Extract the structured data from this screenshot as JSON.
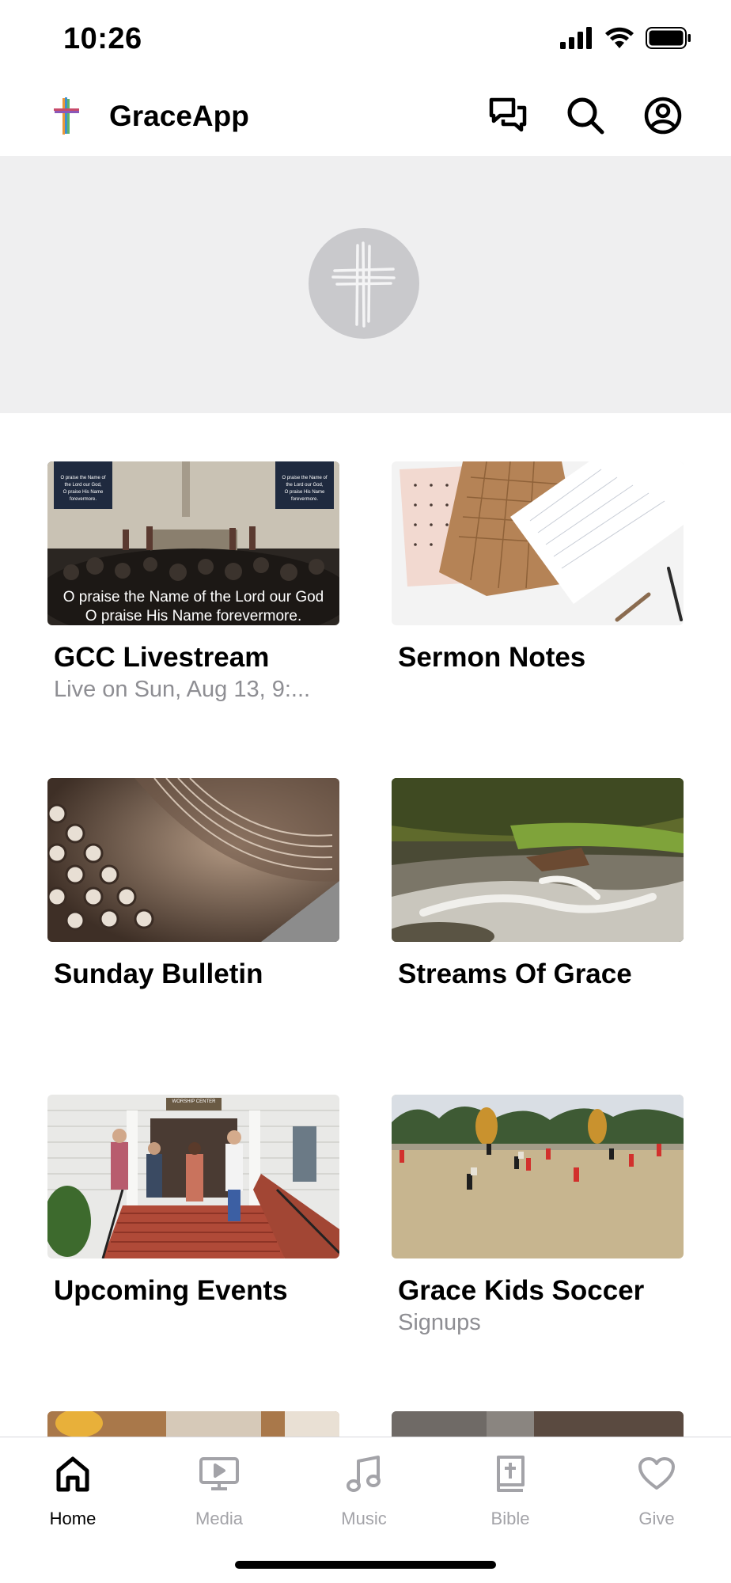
{
  "status_bar": {
    "time": "10:26",
    "icons": [
      "cellular-signal-icon",
      "wifi-icon",
      "battery-icon"
    ]
  },
  "header": {
    "app_name": "GraceApp",
    "logo_icon": "cross-logo-icon",
    "actions": [
      {
        "icon": "chat-icon"
      },
      {
        "icon": "search-icon"
      },
      {
        "icon": "profile-icon"
      }
    ]
  },
  "hero": {
    "emblem_icon": "cross-emblem-icon",
    "background": "#efeff0"
  },
  "cards": [
    {
      "title": "GCC Livestream",
      "subtitle": "Live on Sun, Aug 13, 9:...",
      "image": "worship-service-photo",
      "image_text": {
        "screen_left": "O praise the Name of the Lord our God, O praise His Name forevermore.",
        "caption_line_1": "O praise the Name of the Lord our God",
        "caption_line_2": "O praise His Name forevermore."
      }
    },
    {
      "title": "Sermon Notes",
      "subtitle": "",
      "image": "notebooks-photo"
    },
    {
      "title": "Sunday Bulletin",
      "subtitle": "",
      "image": "typewriter-photo"
    },
    {
      "title": "Streams Of Grace",
      "subtitle": "",
      "image": "creek-photo"
    },
    {
      "title": "Upcoming Events",
      "subtitle": "",
      "image": "church-entrance-photo",
      "image_text": {
        "sign": "WORSHIP CENTER"
      }
    },
    {
      "title": "Grace Kids Soccer",
      "subtitle": "Signups",
      "image": "soccer-field-photo"
    },
    {
      "title": "",
      "subtitle": "",
      "image": "partial-photo-1"
    },
    {
      "title": "",
      "subtitle": "",
      "image": "partial-photo-2"
    }
  ],
  "tab_bar": {
    "tabs": [
      {
        "label": "Home",
        "icon": "home-icon",
        "active": true
      },
      {
        "label": "Media",
        "icon": "media-icon",
        "active": false
      },
      {
        "label": "Music",
        "icon": "music-note-icon",
        "active": false
      },
      {
        "label": "Bible",
        "icon": "bible-icon",
        "active": false
      },
      {
        "label": "Give",
        "icon": "heart-icon",
        "active": false
      }
    ]
  },
  "colors": {
    "active_tab": "#000000",
    "inactive_tab": "#a3a3a8",
    "subtitle": "#8e8e93",
    "hero_bg": "#efeff0"
  }
}
